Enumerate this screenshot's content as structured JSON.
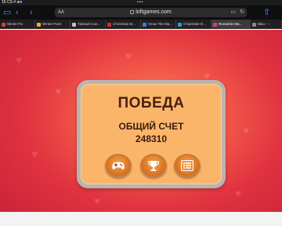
{
  "status_bar": {
    "time": "15",
    "carrier": "CS # anı"
  },
  "toolbar": {
    "address_prefix": "AA",
    "url": "loftgames.com",
    "reader_icon": "reader-icon",
    "reload_icon": "reload-icon"
  },
  "tabs": [
    {
      "label": "Winter Pa",
      "color": "#d04040"
    },
    {
      "label": "Winter Pairs",
      "color": "#f0b020"
    },
    {
      "label": "Тайный Сан...",
      "color": "#c0c0c0"
    },
    {
      "label": "Christmas M...",
      "color": "#d03030"
    },
    {
      "label": "Xmas Tile Ma...",
      "color": "#3080e0"
    },
    {
      "label": "ChipsDale D...",
      "color": "#2a9ad8"
    },
    {
      "label": "Romantic Ma...",
      "color": "#e04060"
    },
    {
      "label": "Blau – ›",
      "color": "#888888"
    }
  ],
  "game": {
    "title": "ПОБЕДА",
    "score_label": "ОБЩИЙ СЧЕТ",
    "score_value": "248310",
    "buttons": [
      "gamepad-icon",
      "trophy-icon",
      "list-icon"
    ]
  }
}
